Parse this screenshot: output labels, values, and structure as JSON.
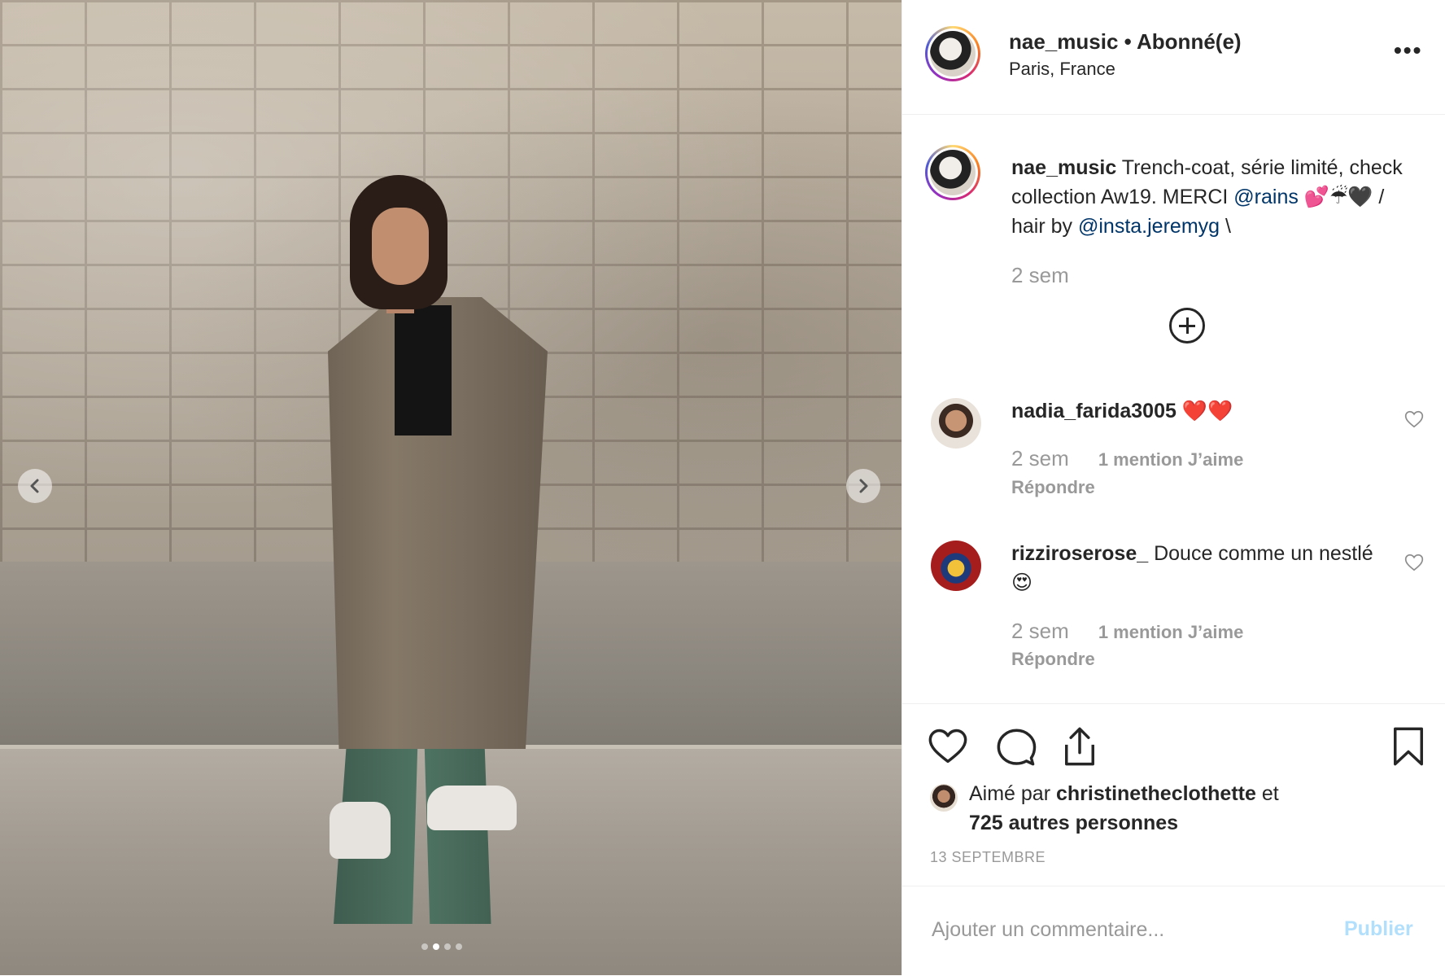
{
  "post": {
    "photo_alt": "photo",
    "carousel": {
      "count": 4,
      "active_index": 1
    }
  },
  "header": {
    "username": "nae_music",
    "separator": "•",
    "follow_state": "Abonné(e)",
    "location": "Paris, France",
    "more_label": "•••"
  },
  "caption": {
    "username": "nae_music",
    "text_1": "Trench-coat, série limité, check collection Aw19. MERCI",
    "mention_1": "@rains",
    "text_2": "💕☔🖤 / hair by",
    "mention_2": "@insta.jeremyg",
    "text_3": "\\",
    "time": "2 sem"
  },
  "comments": [
    {
      "username": "nadia_farida3005",
      "text": "❤️❤️",
      "time": "2 sem",
      "likes": "1 mention J’aime",
      "reply": "Répondre"
    },
    {
      "username": "rizziroserose_",
      "text": "Douce comme un nestlé 😍",
      "time": "2 sem",
      "likes": "1 mention J’aime",
      "reply": "Répondre"
    }
  ],
  "likes": {
    "prefix": "Aimé par",
    "user": "christinetheclothette",
    "suffix": "et",
    "others": "725 autres personnes"
  },
  "date": "13 SEPTEMBRE",
  "composer": {
    "placeholder": "Ajouter un commentaire...",
    "publish_label": "Publier"
  },
  "colors": {
    "mention": "#003569",
    "meta_grey": "#999999",
    "publish_disabled": "#b2dffc"
  }
}
